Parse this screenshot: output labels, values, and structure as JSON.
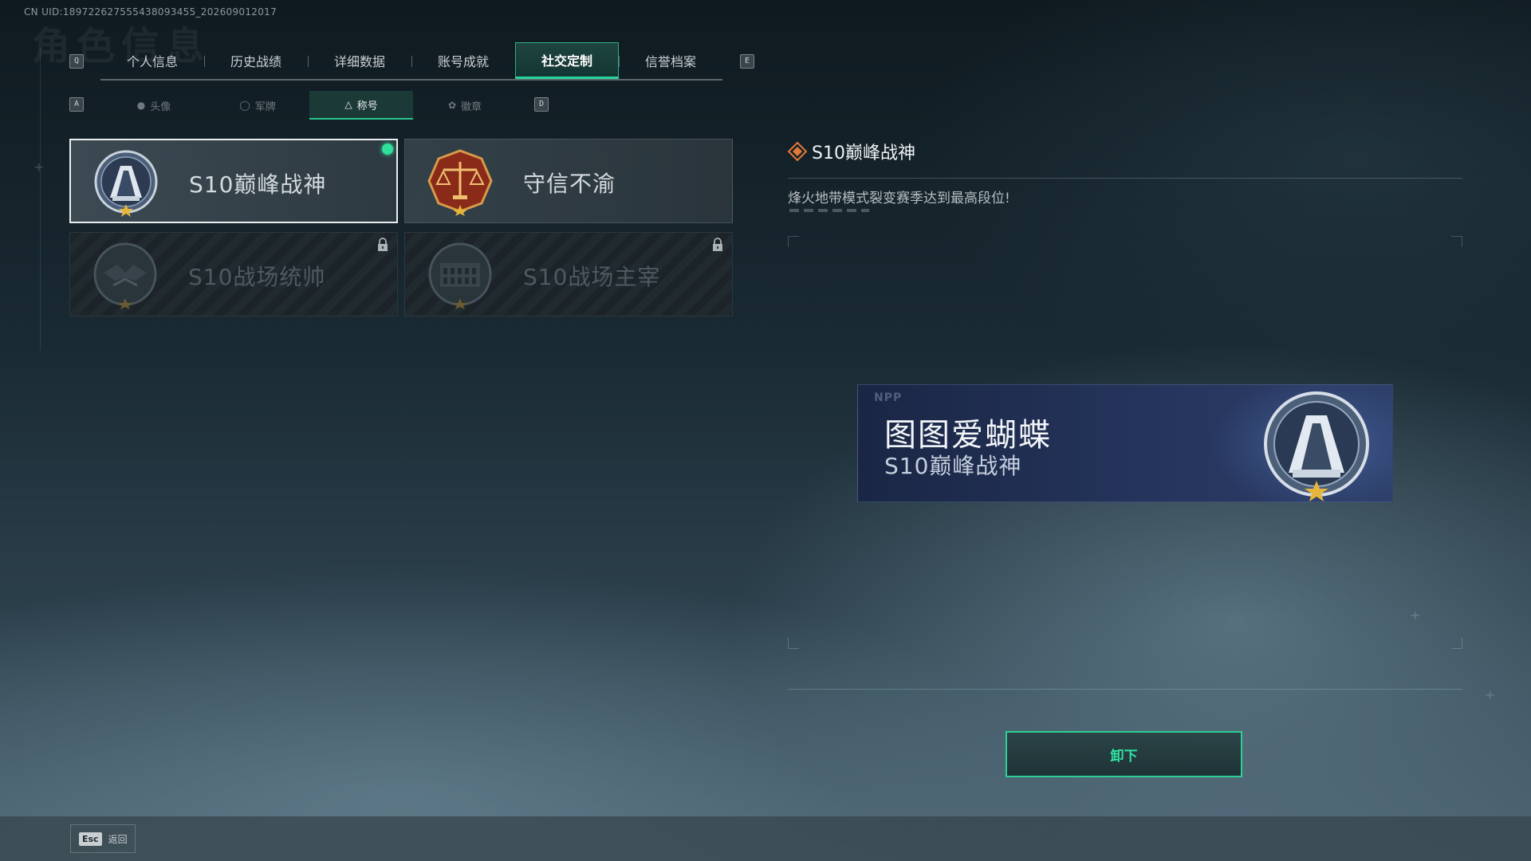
{
  "uid_text": "CN UID:1897226275554380934​55_202609012017",
  "watermark_title": "角色信息",
  "key_hints": {
    "prev_main": "Q",
    "next_main": "E",
    "prev_sub": "A",
    "next_sub": "D"
  },
  "main_tabs": [
    {
      "label": "个人信息",
      "active": false
    },
    {
      "label": "历史战绩",
      "active": false
    },
    {
      "label": "详细数据",
      "active": false
    },
    {
      "label": "账号成就",
      "active": false
    },
    {
      "label": "社交定制",
      "active": true
    },
    {
      "label": "信誉档案",
      "active": false
    }
  ],
  "sub_tabs": [
    {
      "label": "头像",
      "icon": "person-icon",
      "active": false
    },
    {
      "label": "军牌",
      "icon": "shield-icon",
      "active": false
    },
    {
      "label": "称号",
      "icon": "triangle-icon",
      "active": true
    },
    {
      "label": "徽章",
      "icon": "wing-icon",
      "active": false
    }
  ],
  "titles": [
    {
      "name": "S10巅峰战神",
      "icon": "peak-war-god-badge-icon",
      "selected": true,
      "equipped": true,
      "locked": false
    },
    {
      "name": "守信不渝",
      "icon": "scales-badge-icon",
      "selected": false,
      "equipped": false,
      "locked": false
    },
    {
      "name": "S10战场统帅",
      "icon": "dragon-badge-icon",
      "selected": false,
      "equipped": false,
      "locked": true
    },
    {
      "name": "S10战场主宰",
      "icon": "colosseum-badge-icon",
      "selected": false,
      "equipped": false,
      "locked": true
    }
  ],
  "detail": {
    "title": "S10巅峰战神",
    "description": "烽火地带模式裂变赛季达到最高段位!"
  },
  "nameplate": {
    "logo": "NPP",
    "player_name": "图图爱蝴蝶",
    "title": "S10巅峰战神"
  },
  "actions": {
    "unequip_label": "卸下"
  },
  "footer": {
    "esc_key": "Esc",
    "back_label": "返回"
  },
  "colors": {
    "accent": "#2ccf94",
    "equipped_dot": "#2ee09a",
    "star": "#e7b53c",
    "diamond": "#e27a3a"
  }
}
